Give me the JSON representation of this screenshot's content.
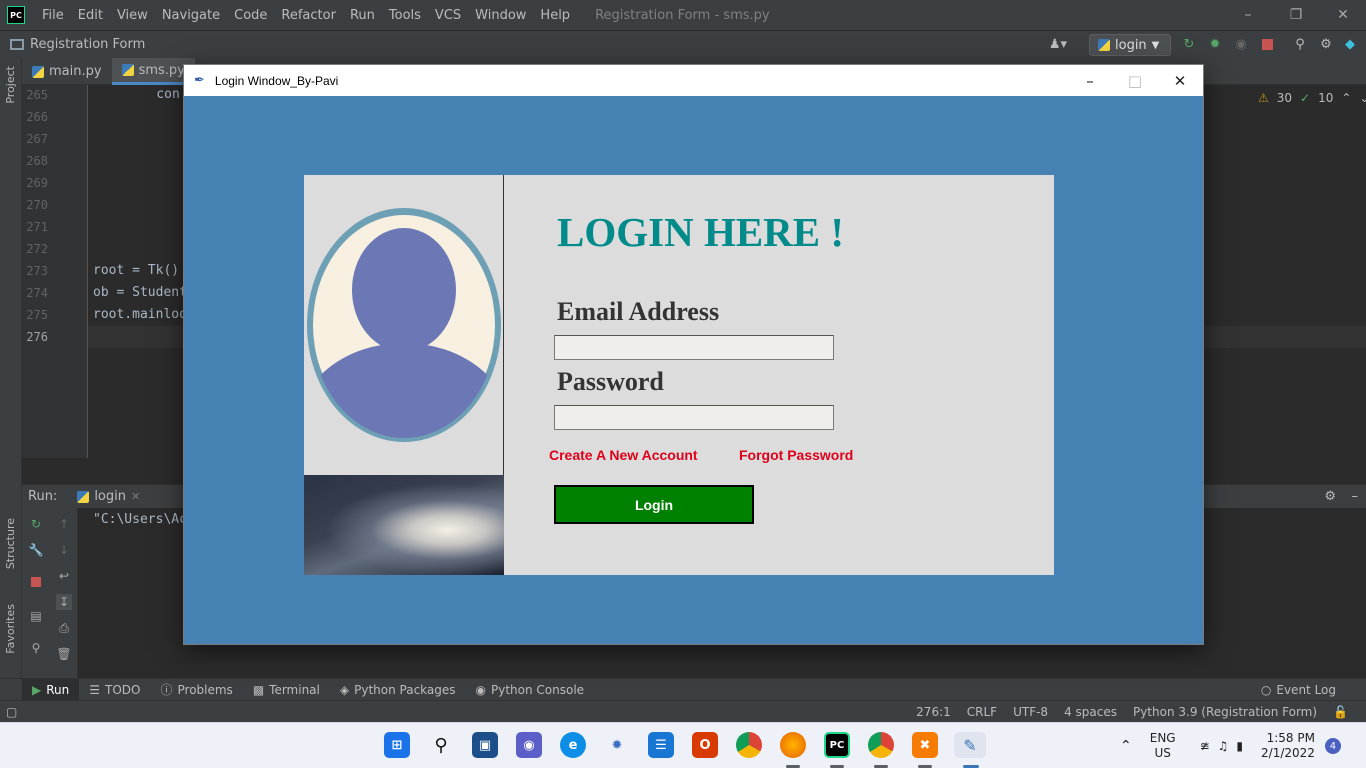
{
  "ide": {
    "logo": "PC",
    "menu": [
      "File",
      "Edit",
      "View",
      "Navigate",
      "Code",
      "Refactor",
      "Run",
      "Tools",
      "VCS",
      "Window",
      "Help"
    ],
    "window_title": "Registration Form - sms.py",
    "breadcrumb": "Registration Form",
    "run_config": "login",
    "tabs": [
      {
        "label": "main.py"
      },
      {
        "label": "sms.py"
      }
    ],
    "line_numbers": [
      "265",
      "266",
      "267",
      "268",
      "269",
      "270",
      "271",
      "272",
      "273",
      "274",
      "275",
      "276"
    ],
    "code_lines": {
      "l265": "    con",
      "l273": "root = Tk()",
      "l274": "ob = Student",
      "l275": "root.mainloo"
    },
    "inspections": {
      "warnings": "30",
      "ok": "10"
    },
    "side_labels": {
      "project": "Project",
      "structure": "Structure",
      "favorites": "Favorites"
    },
    "run_label": "Run:",
    "run_tab": "login",
    "console_text": "\"C:\\Users\\Ac",
    "tool_windows": [
      "Run",
      "TODO",
      "Problems",
      "Terminal",
      "Python Packages",
      "Python Console"
    ],
    "event_log": "Event Log",
    "status": {
      "position": "276:1",
      "line_sep": "CRLF",
      "encoding": "UTF-8",
      "indent": "4 spaces",
      "interpreter": "Python 3.9 (Registration Form)"
    }
  },
  "login_window": {
    "title": "Login Window_By-Pavi",
    "heading": "LOGIN HERE !",
    "email_label": "Email Address",
    "email_value": "",
    "password_label": "Password",
    "password_value": "",
    "create_account": "Create A New Account",
    "forgot_password": "Forgot Password",
    "login_button": "Login",
    "colors": {
      "background": "#4682b4",
      "heading": "#008b8b",
      "links": "#e0001a",
      "button": "#008000",
      "panel": "#dcdcdc"
    }
  },
  "taskbar": {
    "lang": "ENG",
    "region": "US",
    "time": "1:58 PM",
    "date": "2/1/2022",
    "notifications": "4"
  }
}
